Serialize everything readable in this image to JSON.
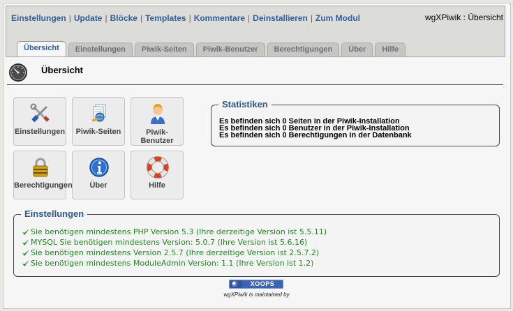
{
  "header": {
    "menu": [
      "Einstellungen",
      "Update",
      "Blöcke",
      "Templates",
      "Kommentare",
      "Deinstallieren",
      "Zum Modul"
    ],
    "module_title": "wgXPiwik : Übersicht",
    "tabs": [
      {
        "label": "Übersicht",
        "active": true
      },
      {
        "label": "Einstellungen",
        "active": false
      },
      {
        "label": "Piwik-Seiten",
        "active": false
      },
      {
        "label": "Piwik-Benutzer",
        "active": false
      },
      {
        "label": "Berechtigungen",
        "active": false
      },
      {
        "label": "Über",
        "active": false
      },
      {
        "label": "Hilfe",
        "active": false
      }
    ]
  },
  "page": {
    "title": "Übersicht",
    "icon": "dashboard-gauge-icon"
  },
  "buttons": [
    {
      "label": "Einstellungen",
      "icon": "tools-icon"
    },
    {
      "label": "Piwik-Seiten",
      "icon": "web-pages-icon"
    },
    {
      "label": "Piwik-Benutzer",
      "icon": "user-icon"
    },
    {
      "label": "Berechtigungen",
      "icon": "lock-icon"
    },
    {
      "label": "Über",
      "icon": "info-icon"
    },
    {
      "label": "Hilfe",
      "icon": "lifebuoy-icon"
    }
  ],
  "stats": {
    "legend": "Statistiken",
    "lines": [
      "Es befinden sich 0 Seiten in der Piwik-Installation",
      "Es befinden sich 0 Benutzer in der Piwik-Installation",
      "Es befinden sich 0 Berechtigungen in der Datenbank"
    ]
  },
  "settings": {
    "legend": "Einstellungen",
    "lines": [
      "Sie benötigen mindestens PHP Version 5.3 (Ihre derzeitige Version ist 5.5.11)",
      "MYSQL Sie benötigen mindestens Version: 5.0.7 (Ihre Version ist 5.6.16)",
      "Sie benötigen mindestens Version 2.5.7 (Ihre derzeitige Version ist 2.5.7.2)",
      "Sie benötigen mindestens ModuleAdmin Version: 1.1 (Ihre Version ist 1.2)"
    ]
  },
  "footer": {
    "badge": "XOOPS",
    "maintained": "wgXPiwik is maintained by"
  },
  "colors": {
    "link": "#2f5f9d",
    "success": "#1e8a1e",
    "legend": "#2e5a8a"
  }
}
